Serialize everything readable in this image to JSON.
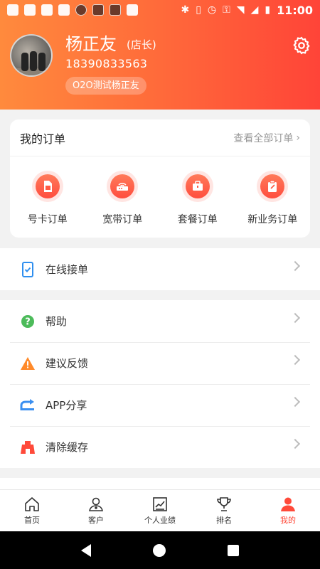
{
  "status_bar": {
    "time": "11:00",
    "icons_left": [
      "notification-icon",
      "pinwheel-icon",
      "image-icon",
      "android-icon",
      "circle-icon",
      "app-icon",
      "app-icon",
      "heartbeat-icon"
    ],
    "icons_right": [
      "bluetooth-icon",
      "vibrate-icon",
      "alarm-icon",
      "key-icon",
      "wifi-icon",
      "signal-icon",
      "battery-icon"
    ]
  },
  "profile": {
    "name": "杨正友",
    "role": "(店长)",
    "phone": "18390833563",
    "store": "O2O测试杨正友"
  },
  "orders": {
    "title": "我的订单",
    "view_all": "查看全部订单",
    "items": [
      {
        "label": "号卡订单",
        "icon": "sim-card-icon"
      },
      {
        "label": "宽带订单",
        "icon": "router-icon"
      },
      {
        "label": "套餐订单",
        "icon": "package-icon"
      },
      {
        "label": "新业务订单",
        "icon": "clipboard-icon"
      }
    ]
  },
  "menu_primary": [
    {
      "label": "在线接单",
      "icon": "phone-check-icon"
    }
  ],
  "menu_secondary": [
    {
      "label": "帮助",
      "icon": "help-icon",
      "color": "#4cbb5a"
    },
    {
      "label": "建议反馈",
      "icon": "warning-icon",
      "color": "#ff8a2a"
    },
    {
      "label": "APP分享",
      "icon": "share-icon",
      "color": "#3a8ff0"
    },
    {
      "label": "清除缓存",
      "icon": "cache-icon",
      "color": "#ff4a3a"
    }
  ],
  "tabbar": [
    {
      "label": "首页",
      "icon": "home-icon"
    },
    {
      "label": "客户",
      "icon": "customer-icon"
    },
    {
      "label": "个人业绩",
      "icon": "performance-icon"
    },
    {
      "label": "排名",
      "icon": "trophy-icon"
    },
    {
      "label": "我的",
      "icon": "person-icon",
      "active": true
    }
  ],
  "colors": {
    "accent": "#ff4a3a",
    "header_gradient_start": "#ff8a3d",
    "header_gradient_end": "#ff4438"
  }
}
